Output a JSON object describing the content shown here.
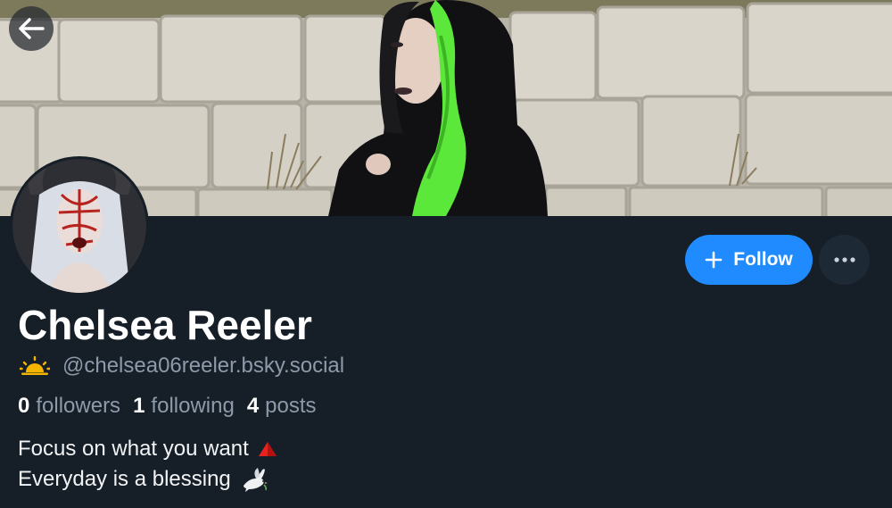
{
  "profile": {
    "display_name": "Chelsea Reeler",
    "handle": "@chelsea06reeler.bsky.social",
    "handle_icon": "sunrise-icon",
    "stats": [
      {
        "value": "0",
        "label": "followers"
      },
      {
        "value": "1",
        "label": "following"
      },
      {
        "value": "4",
        "label": "posts"
      }
    ],
    "bio": [
      {
        "text": "Focus on what you want",
        "emoji": "red-triangle-icon"
      },
      {
        "text": "Everyday is a blessing",
        "emoji": "dove-icon"
      }
    ]
  },
  "actions": {
    "follow_label": "Follow",
    "more_icon": "ellipsis-icon",
    "back_icon": "back-arrow-icon"
  },
  "colors": {
    "background": "#161e27",
    "accent": "#208bfe",
    "muted_text": "#8d9aaa",
    "secondary_button": "#1e2936"
  }
}
